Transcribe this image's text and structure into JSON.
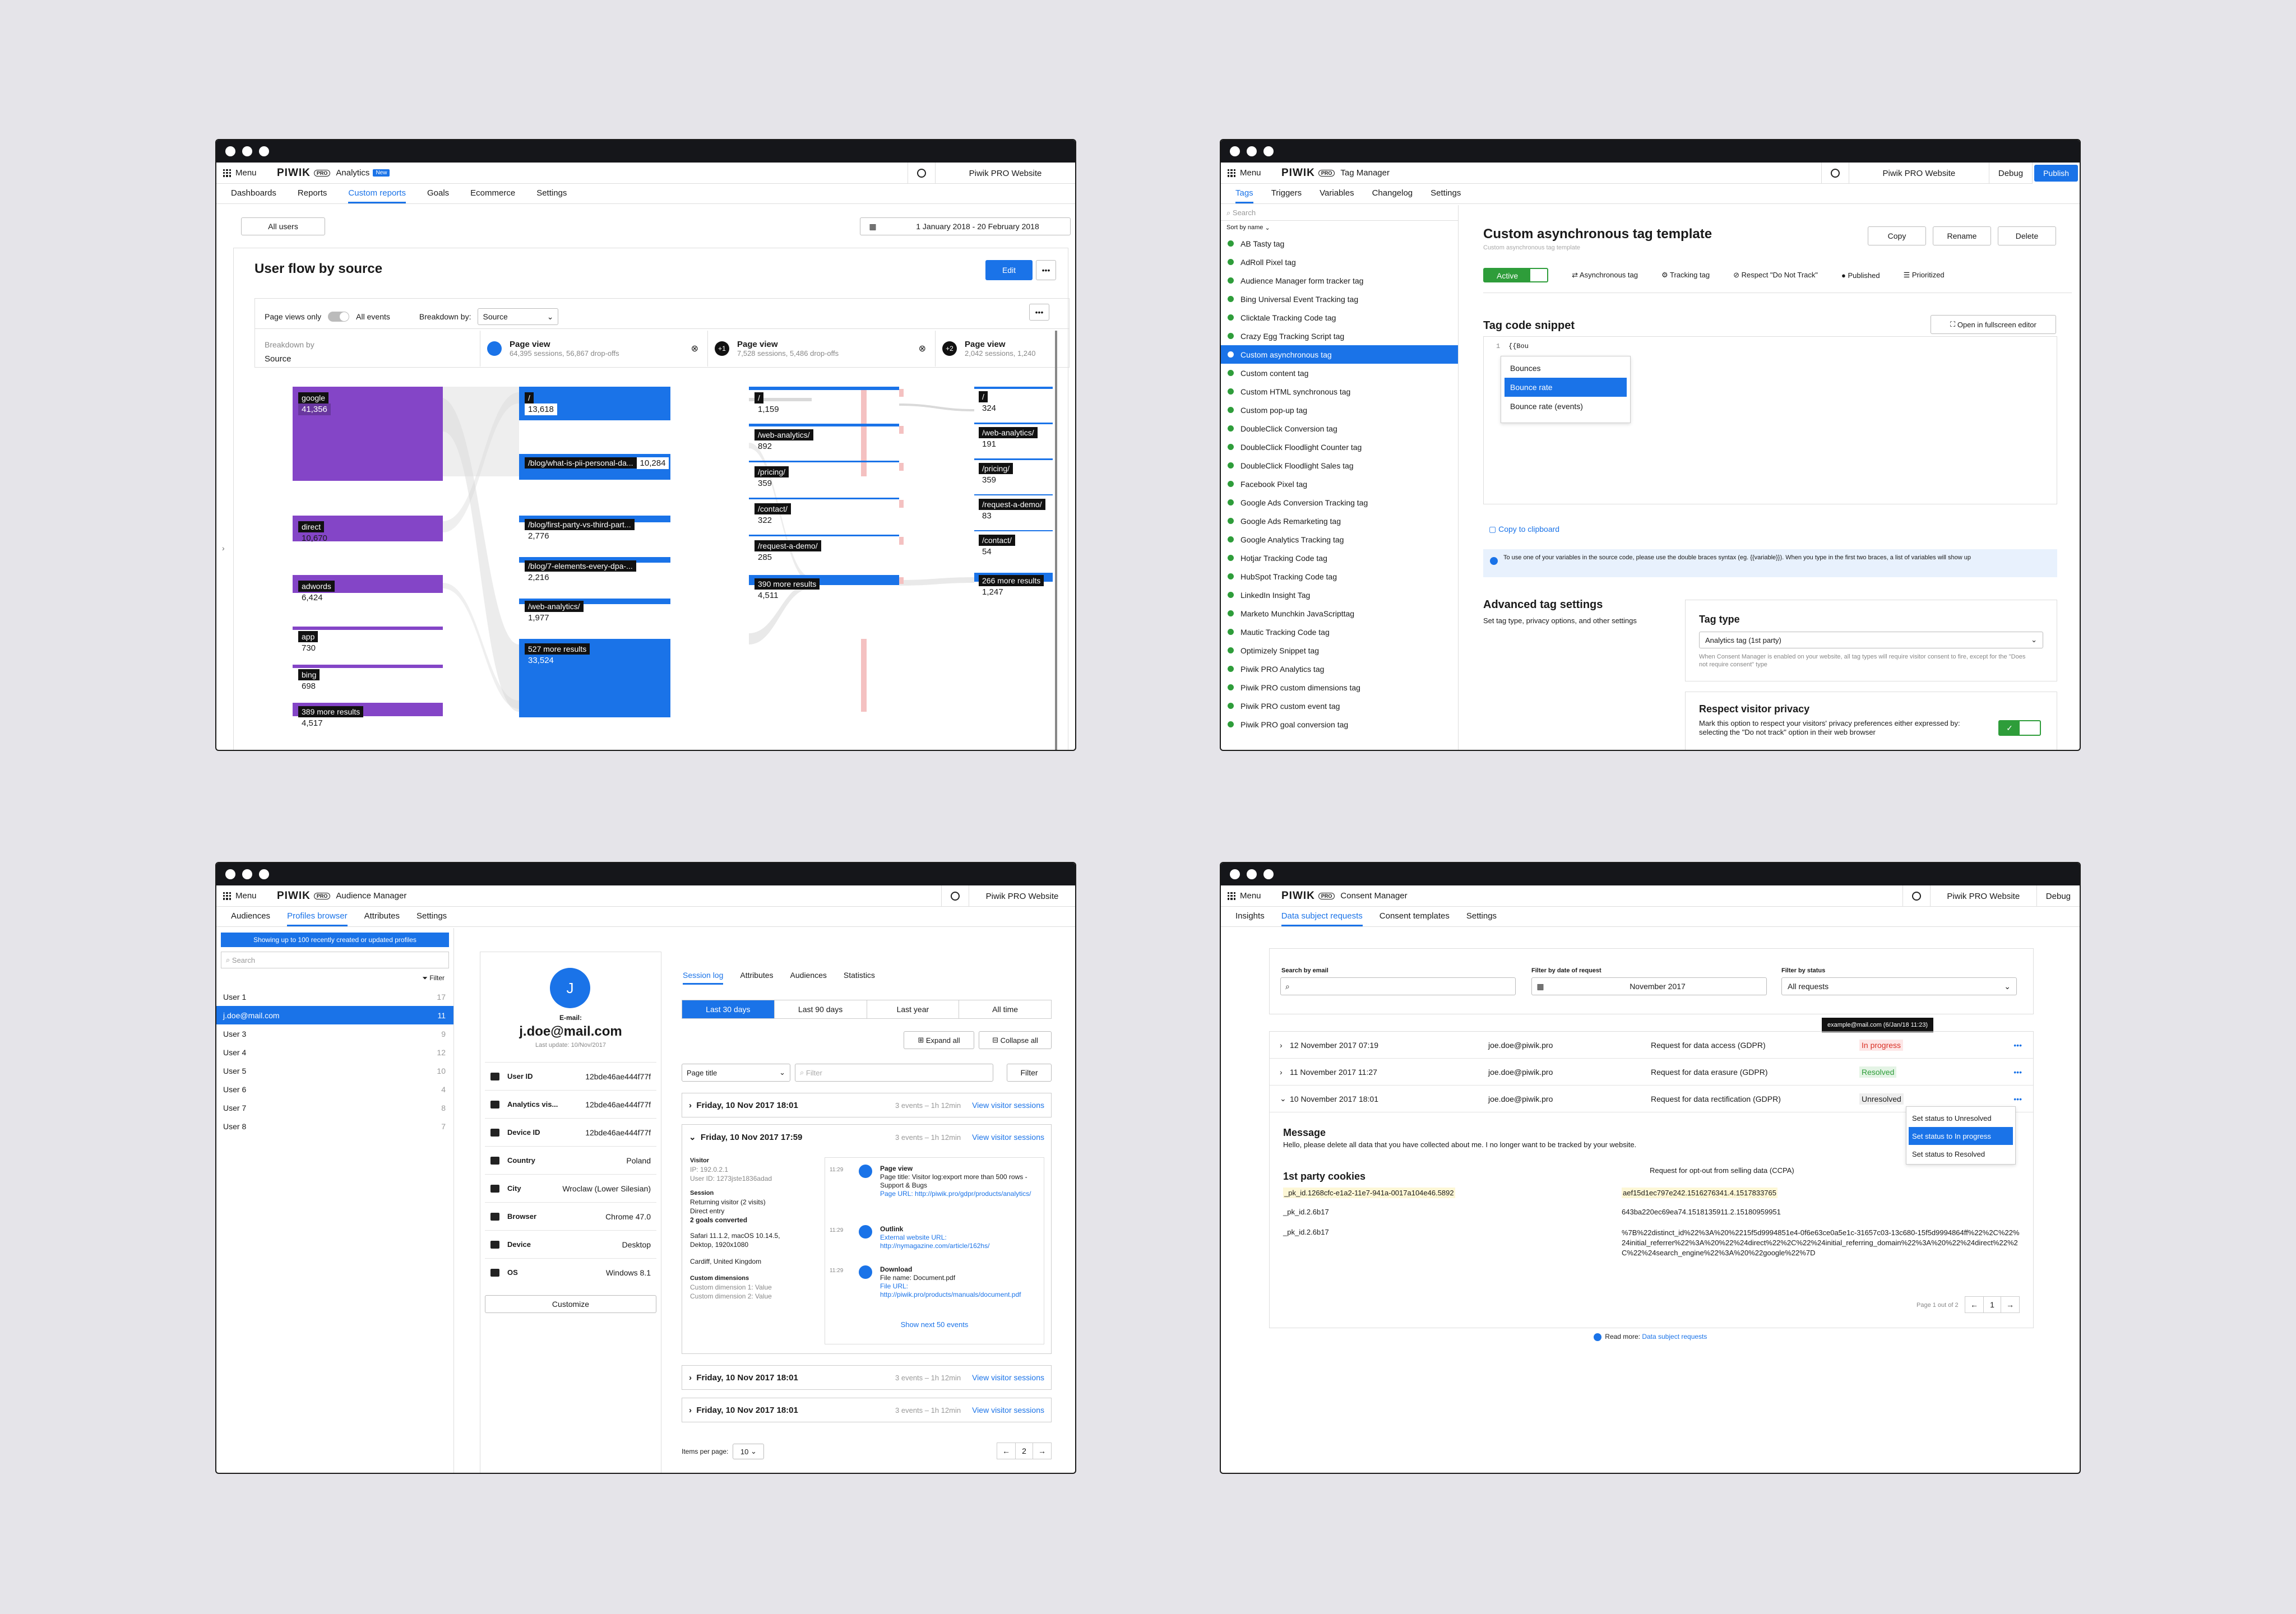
{
  "analytics": {
    "module": "Analytics",
    "badge": "New",
    "website": "Piwik PRO Website",
    "tabs": [
      "Dashboards",
      "Reports",
      "Custom reports",
      "Goals",
      "Ecommerce",
      "Settings"
    ],
    "active_tab": "Custom reports",
    "segment": "All users",
    "date_range": "1 January 2018 - 20 February 2018",
    "title": "User flow by source",
    "edit": "Edit",
    "pageviews_only": "Page views only",
    "all_events": "All events",
    "breakdown_label": "Breakdown by:",
    "breakdown_value": "Source",
    "breakdown_by": "Breakdown by",
    "breakdown_source": "Source",
    "steps": [
      {
        "badge": "",
        "title": "Page view",
        "sub": "64,395 sessions, 56,867 drop-offs"
      },
      {
        "badge": "+1",
        "title": "Page view",
        "sub": "7,528 sessions, 5,486 drop-offs"
      },
      {
        "badge": "+2",
        "title": "Page view",
        "sub": "2,042 sessions, 1,240"
      }
    ],
    "sources": [
      {
        "name": "google",
        "value": "41,356"
      },
      {
        "name": "direct",
        "value": "10,670"
      },
      {
        "name": "adwords",
        "value": "6,424"
      },
      {
        "name": "app",
        "value": "730"
      },
      {
        "name": "bing",
        "value": "698"
      },
      {
        "name": "389 more results",
        "value": "4,517"
      }
    ],
    "col1": [
      {
        "name": "/",
        "value": "13,618"
      },
      {
        "name": "/blog/what-is-pii-personal-da...",
        "value": "10,284"
      },
      {
        "name": "/blog/first-party-vs-third-part...",
        "value": "2,776"
      },
      {
        "name": "/blog/7-elements-every-dpa-...",
        "value": "2,216"
      },
      {
        "name": "/web-analytics/",
        "value": "1,977"
      },
      {
        "name": "527 more results",
        "value": "33,524"
      }
    ],
    "col2": [
      {
        "name": "/",
        "value": "1,159"
      },
      {
        "name": "/web-analytics/",
        "value": "892"
      },
      {
        "name": "/pricing/",
        "value": "359"
      },
      {
        "name": "/contact/",
        "value": "322"
      },
      {
        "name": "/request-a-demo/",
        "value": "285"
      },
      {
        "name": "390 more results",
        "value": "4,511"
      }
    ],
    "col3": [
      {
        "name": "/",
        "value": "324"
      },
      {
        "name": "/web-analytics/",
        "value": "191"
      },
      {
        "name": "/pricing/",
        "value": "359"
      },
      {
        "name": "/request-a-demo/",
        "value": "83"
      },
      {
        "name": "/contact/",
        "value": "54"
      },
      {
        "name": "266 more results",
        "value": "1,247"
      }
    ]
  },
  "tagmanager": {
    "module": "Tag Manager",
    "website": "Piwik PRO Website",
    "debug": "Debug",
    "publish": "Publish",
    "tabs": [
      "Tags",
      "Triggers",
      "Variables",
      "Changelog",
      "Settings"
    ],
    "active_tab": "Tags",
    "search": "Search",
    "sort": "Sort by name",
    "tags": [
      "AB Tasty tag",
      "AdRoll Pixel tag",
      "Audience Manager form tracker tag",
      "Bing Universal Event Tracking tag",
      "Clicktale Tracking Code tag",
      "Crazy Egg Tracking Script tag",
      "Custom asynchronous tag",
      "Custom content tag",
      "Custom HTML synchronous tag",
      "Custom pop-up tag",
      "DoubleClick Conversion tag",
      "DoubleClick Floodlight Counter tag",
      "DoubleClick Floodlight Sales tag",
      "Facebook Pixel tag",
      "Google Ads Conversion Tracking tag",
      "Google Ads Remarketing tag",
      "Google Analytics Tracking tag",
      "Hotjar Tracking Code tag",
      "HubSpot Tracking Code tag",
      "LinkedIn Insight Tag",
      "Marketo Munchkin JavaScripttag",
      "Mautic Tracking Code tag",
      "Optimizely Snippet tag",
      "Piwik PRO Analytics tag",
      "Piwik PRO custom dimensions tag",
      "Piwik PRO custom event tag",
      "Piwik PRO goal conversion tag"
    ],
    "selected": "Custom asynchronous tag",
    "title": "Custom asynchronous tag template",
    "subtitle": "Custom asynchronous tag template",
    "copy": "Copy",
    "rename": "Rename",
    "delete": "Delete",
    "status": {
      "active": "Active",
      "async": "Asynchronous tag",
      "tracking": "Tracking tag",
      "dnt": "Respect \"Do Not Track\"",
      "published": "Published",
      "prioritized": "Prioritized"
    },
    "snippet_title": "Tag code snippet",
    "fullscreen": "Open in fullscreen editor",
    "code_line": "1",
    "code": "{{Bou",
    "suggest": [
      "Bounces",
      "Bounce rate",
      "Bounce rate (events)"
    ],
    "clipboard": "Copy to clipboard",
    "info": "To use one of your variables in the source code, please use the double braces syntax (eg. {{variable}}). When you type in the first two braces, a list of variables will show up",
    "adv_title": "Advanced tag settings",
    "adv_desc": "Set tag type, privacy options, and other settings",
    "tagtype_title": "Tag type",
    "tagtype_value": "Analytics tag (1st party)",
    "tagtype_note": "When Consent Manager is enabled on your website, all tag types will require visitor consent to fire, except for the \"Does not require consent\" type",
    "privacy_title": "Respect visitor privacy",
    "privacy_desc": "Mark this option to respect your visitors' privacy preferences either expressed by: selecting the \"Do not track\" option in their web browser"
  },
  "audience": {
    "module": "Audience Manager",
    "website": "Piwik PRO Website",
    "tabs": [
      "Audiences",
      "Profiles browser",
      "Attributes",
      "Settings"
    ],
    "active_tab": "Profiles browser",
    "banner": "Showing up to 100 recently created or updated profiles",
    "search": "Search",
    "filter": "Filter",
    "users": [
      {
        "name": "User 1",
        "count": "17"
      },
      {
        "name": "j.doe@mail.com",
        "count": "11"
      },
      {
        "name": "User 3",
        "count": "9"
      },
      {
        "name": "User 4",
        "count": "12"
      },
      {
        "name": "User 5",
        "count": "10"
      },
      {
        "name": "User 6",
        "count": "4"
      },
      {
        "name": "User 7",
        "count": "8"
      },
      {
        "name": "User 8",
        "count": "7"
      }
    ],
    "avatar": "J",
    "email_label": "E-mail:",
    "email": "j.doe@mail.com",
    "last_update": "Last update: 10/Nov/2017",
    "props": [
      {
        "k": "User ID",
        "v": "12bde46ae444f77f"
      },
      {
        "k": "Analytics vis...",
        "v": "12bde46ae444f77f"
      },
      {
        "k": "Device ID",
        "v": "12bde46ae444f77f"
      },
      {
        "k": "Country",
        "v": "Poland"
      },
      {
        "k": "City",
        "v": "Wroclaw (Lower Silesian)"
      },
      {
        "k": "Browser",
        "v": "Chrome 47.0"
      },
      {
        "k": "Device",
        "v": "Desktop"
      },
      {
        "k": "OS",
        "v": "Windows 8.1"
      }
    ],
    "customize": "Customize",
    "ptabs": [
      "Session log",
      "Attributes",
      "Audiences",
      "Statistics"
    ],
    "ranges": [
      "Last 30 days",
      "Last 90 days",
      "Last year",
      "All time"
    ],
    "expand": "Expand all",
    "collapse": "Collapse all",
    "page_title": "Page title",
    "filter_ph": "Filter",
    "filter_btn": "Filter",
    "sessions": [
      {
        "date": "Friday, 10 Nov 2017 18:01",
        "meta": "3 events – 1h 12min",
        "link": "View visitor sessions"
      },
      {
        "date": "Friday, 10 Nov 2017 17:59",
        "meta": "3 events – 1h 12min",
        "link": "View visitor sessions"
      },
      {
        "date": "Friday, 10 Nov 2017 18:01",
        "meta": "3 events – 1h 12min",
        "link": "View visitor sessions"
      },
      {
        "date": "Friday, 10 Nov 2017 18:01",
        "meta": "3 events – 1h 12min",
        "link": "View visitor sessions"
      }
    ],
    "visitor": {
      "title": "Visitor",
      "ip": "IP: 192.0.2.1",
      "uid": "User ID: 1273jste1836adad",
      "session": "Session",
      "returning": "Returning visitor (2 visits)",
      "direct": "Direct entry",
      "goals": "2 goals converted",
      "browser": "Safari 11.1.2, macOS 10.14.5, Dektop, 1920x1080",
      "location": "Cardiff, United Kingdom",
      "cd": "Custom dimensions",
      "cd1": "Custom dimension 1: Value",
      "cd2": "Custom dimension 2: Value"
    },
    "events": [
      {
        "time": "11:29",
        "title": "Page view",
        "l1": "Page title: Visitor log:export more than 500 rows - Support & Bugs",
        "l2": "Page URL: http://piwik.pro/gdpr/products/analytics/"
      },
      {
        "time": "11:29",
        "title": "Outlink",
        "l1": "External website URL: http://nymagazine.com/article/162hs/",
        "l2": ""
      },
      {
        "time": "11:29",
        "title": "Download",
        "l1": "File name: Document.pdf",
        "l2": "File URL: http://piwik.pro/products/manuals/document.pdf"
      }
    ],
    "show_next": "Show next 50 events",
    "items_label": "Items per page:",
    "items_value": "10",
    "page": "2"
  },
  "consent": {
    "module": "Consent Manager",
    "website": "Piwik PRO Website",
    "debug": "Debug",
    "tabs": [
      "Insights",
      "Data subject requests",
      "Consent templates",
      "Settings"
    ],
    "active_tab": "Data subject requests",
    "search_label": "Search by email",
    "date_label": "Filter by date of request",
    "date_value": "November 2017",
    "status_label": "Filter by status",
    "status_value": "All requests",
    "tooltip": "example@mail.com (6/Jan/18 11:23)",
    "rows": [
      {
        "date": "12 November 2017 07:19",
        "email": "joe.doe@piwik.pro",
        "req": "Request for data access (GDPR)",
        "status": "In progress",
        "color": "#d93025"
      },
      {
        "date": "11 November 2017 11:27",
        "email": "joe.doe@piwik.pro",
        "req": "Request for data erasure (GDPR)",
        "status": "Resolved",
        "color": "#2e9d3a"
      },
      {
        "date": "10 November 2017 18:01",
        "email": "joe.doe@piwik.pro",
        "req": "Request for data rectification (GDPR)",
        "status": "Unresolved",
        "color": "#1a1a1a"
      }
    ],
    "menu": [
      "Set status to Unresolved",
      "Set status to In progress",
      "Set status to Resolved"
    ],
    "msg_title": "Message",
    "msg": "Hello, please delete all data that you have collected about me. I no longer want to be tracked by your website.",
    "ccpa": "Request for opt-out from selling data (CCPA)",
    "cookies_title": "1st party cookies",
    "cookies": [
      {
        "k": "_pk_id.1268cfc-e1a2-11e7-941a-0017a104e46.5892",
        "v": "aef15d1ec797e242.1516276341.4.1517833765"
      },
      {
        "k": "_pk_id.2.6b17",
        "v": "643ba220ec69ea74.1518135911.2.15180959951"
      },
      {
        "k": "_pk_id.2.6b17",
        "v": "%7B%22distinct_id%22%3A%20%2215f5d9994851e4-0f6e63ce0a5e1c-31657c03-13c680-15f5d9994864ff%22%2C%22%24initial_referrer%22%3A%20%22%24direct%22%2C%22%24initial_referring_domain%22%3A%20%22%24direct%22%2C%22%24search_engine%22%3A%20%22google%22%7D"
      }
    ],
    "page_info": "Page 1 out of 2",
    "page": "1",
    "read_more": "Read more:",
    "read_link": "Data subject requests"
  }
}
